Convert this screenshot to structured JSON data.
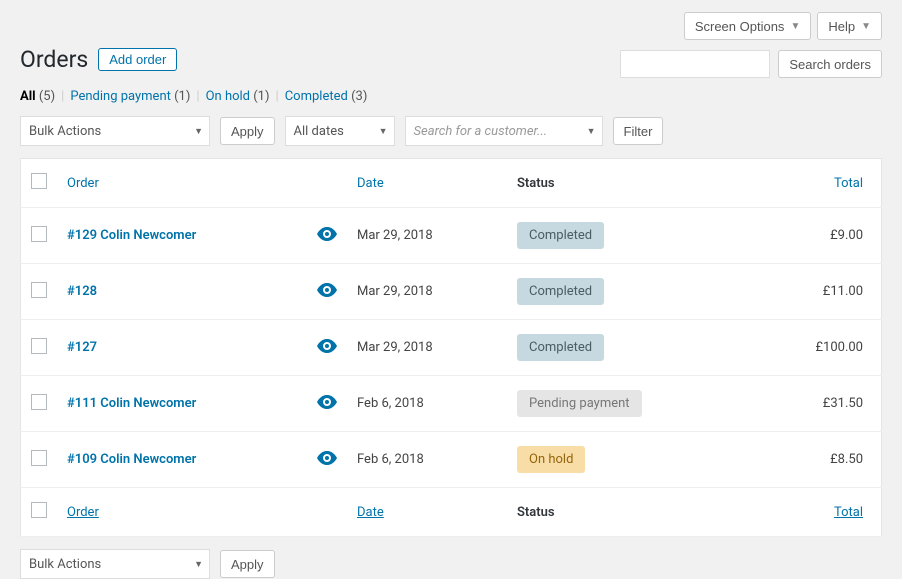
{
  "topButtons": {
    "screenOptions": "Screen Options",
    "help": "Help"
  },
  "pageTitle": "Orders",
  "addButton": "Add order",
  "statusFilters": [
    {
      "label": "All",
      "count": "(5)",
      "active": true
    },
    {
      "label": "Pending payment",
      "count": "(1)",
      "active": false
    },
    {
      "label": "On hold",
      "count": "(1)",
      "active": false
    },
    {
      "label": "Completed",
      "count": "(3)",
      "active": false
    }
  ],
  "search": {
    "button": "Search orders"
  },
  "bulkActions": {
    "placeholder": "Bulk Actions",
    "apply": "Apply"
  },
  "dateFilter": {
    "label": "All dates"
  },
  "customerFilter": {
    "placeholder": "Search for a customer..."
  },
  "filterButton": "Filter",
  "columns": {
    "order": "Order",
    "date": "Date",
    "status": "Status",
    "total": "Total"
  },
  "orders": [
    {
      "title": "#129 Colin Newcomer",
      "date": "Mar 29, 2018",
      "status": "Completed",
      "statusType": "completed",
      "total": "£9.00"
    },
    {
      "title": "#128",
      "date": "Mar 29, 2018",
      "status": "Completed",
      "statusType": "completed",
      "total": "£11.00"
    },
    {
      "title": "#127",
      "date": "Mar 29, 2018",
      "status": "Completed",
      "statusType": "completed",
      "total": "£100.00"
    },
    {
      "title": "#111 Colin Newcomer",
      "date": "Feb 6, 2018",
      "status": "Pending payment",
      "statusType": "pending",
      "total": "£31.50"
    },
    {
      "title": "#109 Colin Newcomer",
      "date": "Feb 6, 2018",
      "status": "On hold",
      "statusType": "onhold",
      "total": "£8.50"
    }
  ]
}
